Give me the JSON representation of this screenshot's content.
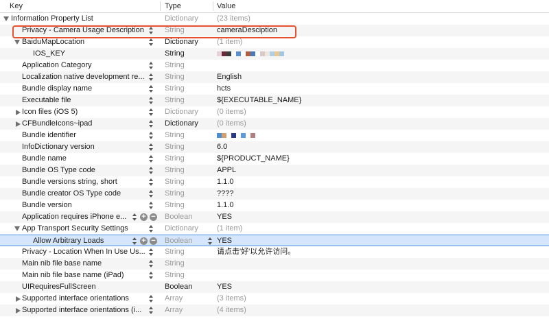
{
  "columns": {
    "key": "Key",
    "type": "Type",
    "value": "Value"
  },
  "rows": [
    {
      "key": "Information Property List",
      "type": "Dictionary",
      "value": "(23 items)",
      "indent": 0,
      "disclosure": "open",
      "typeStyle": "gray",
      "valueStyle": "gray",
      "stepper": false
    },
    {
      "key": "Privacy - Camera Usage Description",
      "type": "String",
      "value": "cameraDesciption",
      "indent": 1,
      "disclosure": "none",
      "typeStyle": "gray",
      "valueStyle": "normal",
      "stepper": true
    },
    {
      "key": "BaiduMapLocation",
      "type": "Dictionary",
      "value": "(1 item)",
      "indent": 1,
      "disclosure": "open",
      "typeStyle": "dark",
      "valueStyle": "gray",
      "stepper": true
    },
    {
      "key": "IOS_KEY",
      "type": "String",
      "value": "",
      "indent": 2,
      "disclosure": "none",
      "typeStyle": "dark",
      "valueStyle": "normal",
      "stepper": false,
      "swatches": [
        "#e6d2d8",
        "#6b2a3a",
        "#3a3a3a",
        "#ffffff",
        "#5a8fd0",
        "#ffffff",
        "#b06040",
        "#4a7ab8",
        "#ffffff",
        "#d8c8c8",
        "#f0e8e0",
        "#b0d0e8",
        "#e8c890",
        "#a0c8e0"
      ]
    },
    {
      "key": "Application Category",
      "type": "String",
      "value": "",
      "indent": 1,
      "disclosure": "none",
      "typeStyle": "gray",
      "valueStyle": "normal",
      "stepper": true
    },
    {
      "key": "Localization native development re...",
      "type": "String",
      "value": "English",
      "indent": 1,
      "disclosure": "none",
      "typeStyle": "gray",
      "valueStyle": "normal",
      "stepper": true
    },
    {
      "key": "Bundle display name",
      "type": "String",
      "value": "hcts",
      "indent": 1,
      "disclosure": "none",
      "typeStyle": "gray",
      "valueStyle": "normal",
      "stepper": true
    },
    {
      "key": "Executable file",
      "type": "String",
      "value": "${EXECUTABLE_NAME}",
      "indent": 1,
      "disclosure": "none",
      "typeStyle": "gray",
      "valueStyle": "normal",
      "stepper": true
    },
    {
      "key": "Icon files (iOS 5)",
      "type": "Dictionary",
      "value": "(0 items)",
      "indent": 1,
      "disclosure": "closed",
      "typeStyle": "gray",
      "valueStyle": "gray",
      "stepper": true
    },
    {
      "key": "CFBundleIcons~ipad",
      "type": "Dictionary",
      "value": "(0 items)",
      "indent": 1,
      "disclosure": "closed",
      "typeStyle": "dark",
      "valueStyle": "gray",
      "stepper": true
    },
    {
      "key": "Bundle identifier",
      "type": "String",
      "value": "",
      "indent": 1,
      "disclosure": "none",
      "typeStyle": "gray",
      "valueStyle": "normal",
      "stepper": true,
      "swatches": [
        "#4a8fd0",
        "#d0a070",
        "#ffffff",
        "#2a3a8a",
        "#ffffff",
        "#5a9ad8",
        "#ffffff",
        "#b08080"
      ]
    },
    {
      "key": "InfoDictionary version",
      "type": "String",
      "value": "6.0",
      "indent": 1,
      "disclosure": "none",
      "typeStyle": "gray",
      "valueStyle": "normal",
      "stepper": true
    },
    {
      "key": "Bundle name",
      "type": "String",
      "value": "${PRODUCT_NAME}",
      "indent": 1,
      "disclosure": "none",
      "typeStyle": "gray",
      "valueStyle": "normal",
      "stepper": true
    },
    {
      "key": "Bundle OS Type code",
      "type": "String",
      "value": "APPL",
      "indent": 1,
      "disclosure": "none",
      "typeStyle": "gray",
      "valueStyle": "normal",
      "stepper": true
    },
    {
      "key": "Bundle versions string, short",
      "type": "String",
      "value": "1.1.0",
      "indent": 1,
      "disclosure": "none",
      "typeStyle": "gray",
      "valueStyle": "normal",
      "stepper": true
    },
    {
      "key": "Bundle creator OS Type code",
      "type": "String",
      "value": "????",
      "indent": 1,
      "disclosure": "none",
      "typeStyle": "gray",
      "valueStyle": "normal",
      "stepper": true
    },
    {
      "key": "Bundle version",
      "type": "String",
      "value": "1.1.0",
      "indent": 1,
      "disclosure": "none",
      "typeStyle": "gray",
      "valueStyle": "normal",
      "stepper": true
    },
    {
      "key": "Application requires iPhone e...",
      "type": "Boolean",
      "value": "YES",
      "indent": 1,
      "disclosure": "none",
      "typeStyle": "gray",
      "valueStyle": "normal",
      "stepper": true,
      "addRemove": true
    },
    {
      "key": "App Transport Security Settings",
      "type": "Dictionary",
      "value": "(1 item)",
      "indent": 1,
      "disclosure": "open",
      "typeStyle": "gray",
      "valueStyle": "gray",
      "stepper": true
    },
    {
      "key": "Allow Arbitrary Loads",
      "type": "Boolean",
      "value": "YES",
      "indent": 2,
      "disclosure": "none",
      "typeStyle": "gray",
      "valueStyle": "normal",
      "stepper": true,
      "addRemove": true,
      "selected": true,
      "valueStepper": true
    },
    {
      "key": "Privacy - Location When In Use Us...",
      "type": "String",
      "value": "请点击'好'以允许访问。",
      "indent": 1,
      "disclosure": "none",
      "typeStyle": "gray",
      "valueStyle": "normal",
      "stepper": true
    },
    {
      "key": "Main nib file base name",
      "type": "String",
      "value": "",
      "indent": 1,
      "disclosure": "none",
      "typeStyle": "gray",
      "valueStyle": "normal",
      "stepper": true
    },
    {
      "key": "Main nib file base name (iPad)",
      "type": "String",
      "value": "",
      "indent": 1,
      "disclosure": "none",
      "typeStyle": "gray",
      "valueStyle": "normal",
      "stepper": true
    },
    {
      "key": "UIRequiresFullScreen",
      "type": "Boolean",
      "value": "YES",
      "indent": 1,
      "disclosure": "none",
      "typeStyle": "dark",
      "valueStyle": "normal",
      "stepper": false
    },
    {
      "key": "Supported interface orientations",
      "type": "Array",
      "value": "(3 items)",
      "indent": 1,
      "disclosure": "closed",
      "typeStyle": "gray",
      "valueStyle": "gray",
      "stepper": true
    },
    {
      "key": "Supported interface orientations (i...",
      "type": "Array",
      "value": "(4 items)",
      "indent": 1,
      "disclosure": "closed",
      "typeStyle": "gray",
      "valueStyle": "gray",
      "stepper": true
    }
  ],
  "colors": {
    "highlight": "#e8512f",
    "selection": "#d5e5fb",
    "selectionBorder": "#4a90e2"
  }
}
